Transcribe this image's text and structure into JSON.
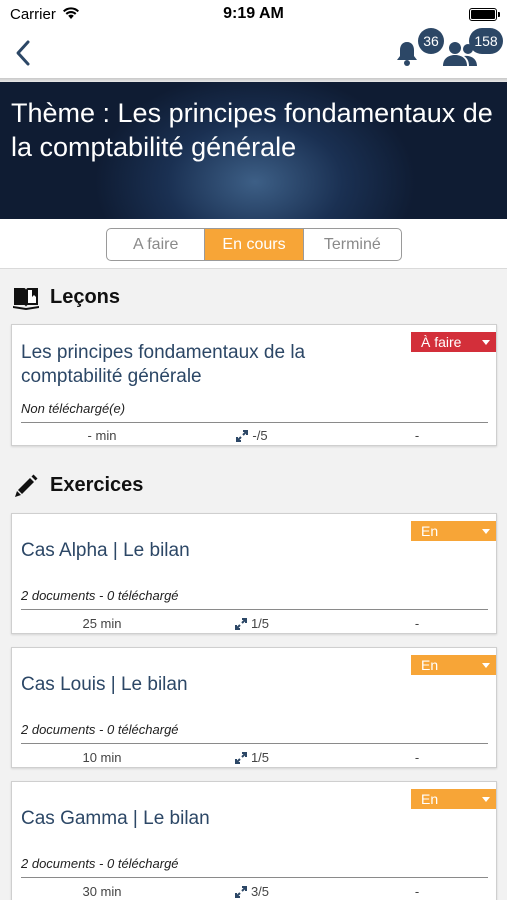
{
  "status_bar": {
    "carrier": "Carrier",
    "time": "9:19 AM"
  },
  "nav": {
    "notification_count": "36",
    "users_count": "158"
  },
  "banner": {
    "title": "Thème : Les principes fondamentaux de la comptabilité générale"
  },
  "segments": [
    {
      "label": "A faire",
      "active": false
    },
    {
      "label": "En cours",
      "active": true
    },
    {
      "label": "Terminé",
      "active": false
    }
  ],
  "lessons": {
    "title": "Leçons",
    "items": [
      {
        "title": "Les principes fondamentaux de la comptabilité générale",
        "subtitle": "Non téléchargé(e)",
        "time": "- min",
        "score": "-/5",
        "extra": "-",
        "status": "À faire",
        "status_color": "#d32f3a"
      }
    ]
  },
  "exercises": {
    "title": "Exercices",
    "items": [
      {
        "title": "Cas Alpha | Le bilan",
        "subtitle": "2 documents -  0 téléchargé",
        "time": "25 min",
        "score": "1/5",
        "extra": "-",
        "status": "En cours",
        "status_color": "#f7a537"
      },
      {
        "title": "Cas Louis | Le bilan",
        "subtitle": "2 documents -  0 téléchargé",
        "time": "10 min",
        "score": "1/5",
        "extra": "-",
        "status": "En cours",
        "status_color": "#f7a537"
      },
      {
        "title": "Cas Gamma | Le bilan",
        "subtitle": "2 documents -  0 téléchargé",
        "time": "30 min",
        "score": "3/5",
        "extra": "-",
        "status": "En cours",
        "status_color": "#f7a537"
      }
    ]
  },
  "colors": {
    "accent": "#f7a537",
    "danger": "#d32f3a",
    "navy": "#2c4766"
  }
}
